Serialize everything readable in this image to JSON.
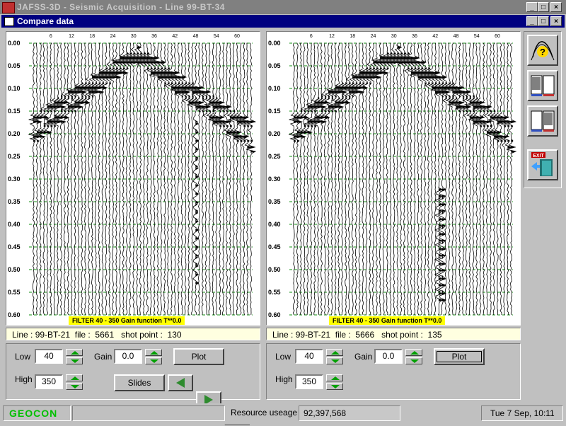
{
  "window": {
    "title": "JAFSS-3D - Seismic Acquisition - Line 99-BT-34"
  },
  "child_window": {
    "title": "Compare data"
  },
  "x_ticks": [
    "6",
    "12",
    "18",
    "24",
    "30",
    "36",
    "42",
    "48",
    "54",
    "60"
  ],
  "y_ticks": [
    "0.00",
    "0.05",
    "0.10",
    "0.15",
    "0.20",
    "0.25",
    "0.30",
    "0.35",
    "0.40",
    "0.45",
    "0.50",
    "0.55",
    "0.60"
  ],
  "panels": [
    {
      "filter_label": "FILTER  40 - 350    Gain function T**0.0",
      "info": {
        "line_label": "Line :",
        "line": "99-BT-21",
        "file_label": "file :",
        "file": "5661",
        "shot_label": "shot point :",
        "shot": "130"
      },
      "controls": {
        "low_label": "Low",
        "low": "40",
        "high_label": "High",
        "high": "350",
        "gain_label": "Gain",
        "gain": "0.0",
        "plot_label": "Plot",
        "slides_label": "Slides"
      }
    },
    {
      "filter_label": "FILTER  40 - 350    Gain function T**0.0",
      "info": {
        "line_label": "Line :",
        "line": "99-BT-21",
        "file_label": "file :",
        "file": "5666",
        "shot_label": "shot point :",
        "shot": "135"
      },
      "controls": {
        "low_label": "Low",
        "low": "40",
        "high_label": "High",
        "high": "350",
        "gain_label": "Gain",
        "gain": "0.0",
        "plot_label": "Plot"
      }
    }
  ],
  "toolbar": {
    "exit_label": "EXIT"
  },
  "status": {
    "brand": "GEOCON",
    "resource_label": "Resource useage",
    "resource_value": "92,397,568",
    "datetime": "Tue 7 Sep, 10:11"
  },
  "colors": {
    "title_active": "#000080",
    "title_inactive": "#808080",
    "info_bg": "#ffffe0",
    "filter_bg": "#ffff00",
    "spin_arrow": "#00a000",
    "brand": "#00c000"
  }
}
